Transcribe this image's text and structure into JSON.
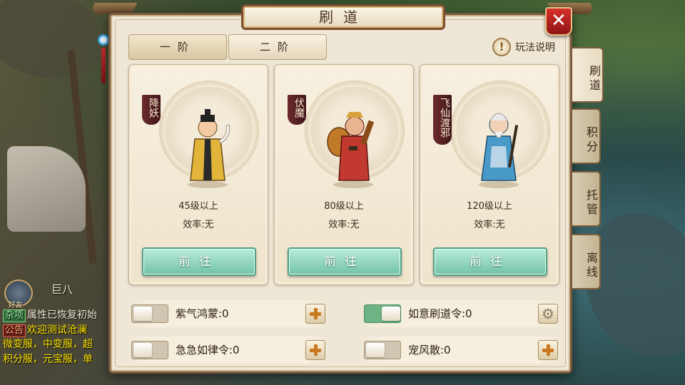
{
  "panel": {
    "title": "刷道",
    "close_label": "✕",
    "tiers": [
      {
        "label": "一阶"
      },
      {
        "label": "二阶"
      }
    ],
    "help_label": "玩法说明",
    "help_icon": "exclamation-icon"
  },
  "cards": [
    {
      "name": "降妖",
      "level": "45级以上",
      "efficiency": "效率:无",
      "button": "前往",
      "robe_color": "#e2b53a"
    },
    {
      "name": "伏魔",
      "level": "80级以上",
      "efficiency": "效率:无",
      "button": "前往",
      "robe_color": "#c2392f"
    },
    {
      "name": "飞仙渡邪",
      "level": "120级以上",
      "efficiency": "效率:无",
      "button": "前往",
      "robe_color": "#4a9ac9"
    }
  ],
  "options": [
    {
      "label": "紫气鸿蒙:0",
      "on": false,
      "action_icon": "plus-icon"
    },
    {
      "label": "如意刷道令:0",
      "on": true,
      "action_icon": "gear-icon"
    },
    {
      "label": "急急如律令:0",
      "on": false,
      "action_icon": "plus-icon"
    },
    {
      "label": "宠风散:0",
      "on": false,
      "action_icon": "plus-icon"
    }
  ],
  "side_tabs": [
    {
      "label": "刷道",
      "active": true
    },
    {
      "label": "积分",
      "active": false
    },
    {
      "label": "托管",
      "active": false
    },
    {
      "label": "离线",
      "active": false
    }
  ],
  "chat": {
    "bubble": "巨八",
    "badge": "好友",
    "lines": [
      {
        "tag": "杂项",
        "text": "属性已恢复初始"
      },
      {
        "tag": "公告",
        "text": "欢迎测试沧澜"
      },
      {
        "tag": "",
        "text": "微变服，中变服，超"
      },
      {
        "tag": "",
        "text": "积分服，元宝服，单"
      }
    ]
  },
  "colors": {
    "accent_green": "#72c3a6",
    "close_red": "#d7302a",
    "toggle_on": "#6db383"
  }
}
